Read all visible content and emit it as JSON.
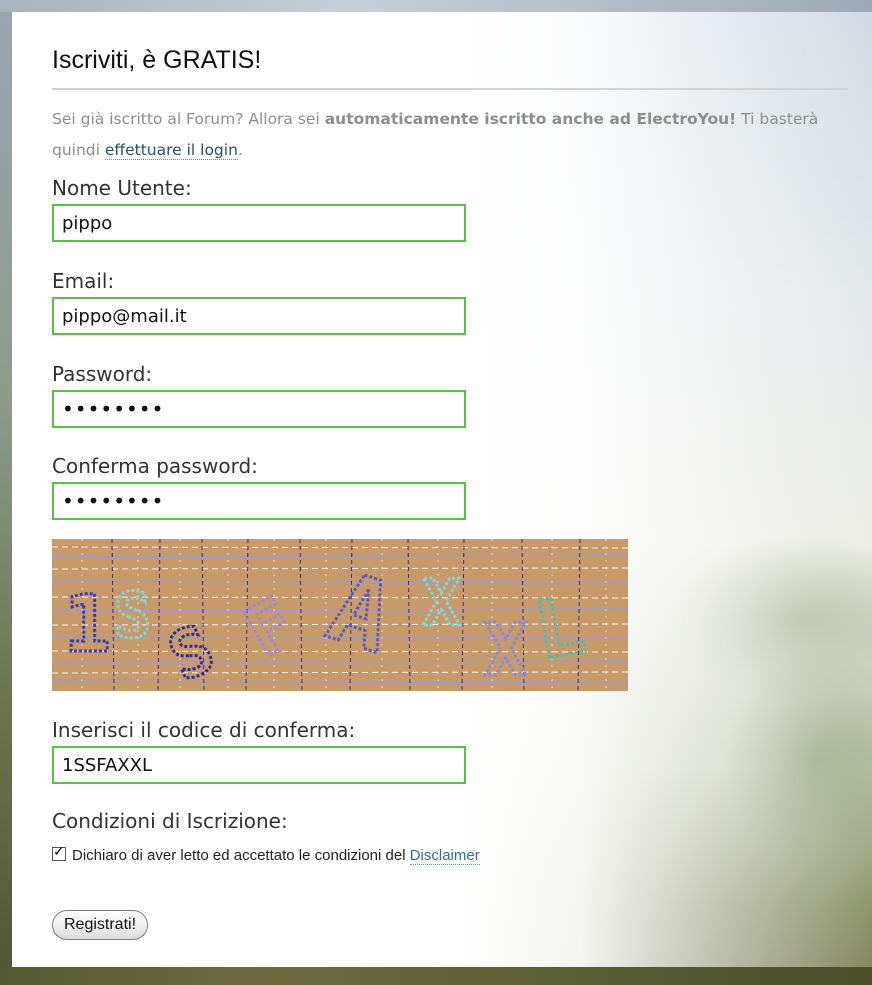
{
  "form": {
    "title": "Iscriviti, è GRATIS!",
    "intro": {
      "part1": "Sei già iscritto al Forum? Allora sei ",
      "bold1": "automaticamente iscritto anche ad ElectroYou!",
      "part2": " Ti basterà quindi ",
      "login_link": "effettuare il login",
      "part3": "."
    },
    "username": {
      "label": "Nome Utente:",
      "value": "pippo"
    },
    "email": {
      "label": "Email:",
      "value": "pippo@mail.it"
    },
    "password": {
      "label": "Password:",
      "value": "••••••••"
    },
    "confirm_password": {
      "label": "Conferma password:",
      "value": "••••••••"
    },
    "captcha": {
      "text": "1SSFAXXL",
      "background": "#c89a6a"
    },
    "captcha_input": {
      "label": "Inserisci il codice di conferma:",
      "value": "1SSFAXXL"
    },
    "terms": {
      "label": "Condizioni di Iscrizione:",
      "checked": true,
      "checkbox_text": "Dichiaro di aver letto ed accettato le condizioni del ",
      "disclaimer_link": "Disclaimer"
    },
    "submit_label": "Registrati!"
  },
  "colors": {
    "input_border": "#55c245",
    "link": "#2b6ea7",
    "intro_text": "#8d8d8d"
  }
}
